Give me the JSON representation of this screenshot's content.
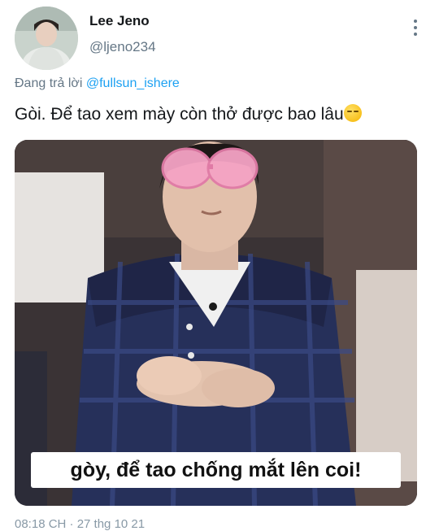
{
  "tweet": {
    "display_name": "Lee Jeno",
    "handle": "@ljeno234",
    "reply_prefix": "Đang trả lời ",
    "reply_mention": "@fullsun_ishere",
    "text": "Gòi. Để tao xem mày còn thở được bao lâu",
    "emoji": "smirking-face-emoji",
    "media_caption": "gòy, để tao chống mắt lên coi!",
    "timestamp": "08:18 CH · 27 thg 10 21"
  },
  "colors": {
    "link": "#1da1f2",
    "secondary_text": "#657786",
    "primary_text": "#14171a"
  }
}
